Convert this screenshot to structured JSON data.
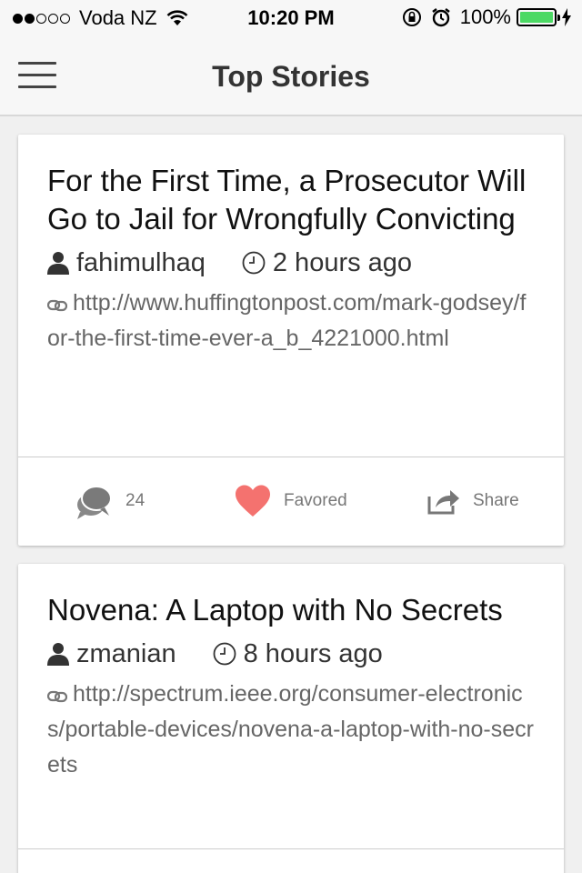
{
  "status": {
    "carrier": "Voda NZ",
    "time": "10:20 PM",
    "battery": "100%",
    "battery_level": 1.0,
    "signal_bars": 2
  },
  "nav": {
    "title": "Top Stories"
  },
  "stories": [
    {
      "title": "For the First Time, a Prosecutor Will Go to Jail for Wrongfully Convicting",
      "author": "fahimulhaq",
      "time": "2 hours ago",
      "url": "http://www.huffingtonpost.com/mark-godsey/for-the-first-time-ever-a_b_4221000.html",
      "comments": "24",
      "favored_label": "Favored",
      "share_label": "Share"
    },
    {
      "title": "Novena: A Laptop with No Secrets",
      "author": "zmanian",
      "time": "8 hours ago",
      "url": "http://spectrum.ieee.org/consumer-electronics/portable-devices/novena-a-laptop-with-no-secrets"
    }
  ],
  "colors": {
    "favorite": "#f4726f",
    "battery": "#4cd964"
  }
}
